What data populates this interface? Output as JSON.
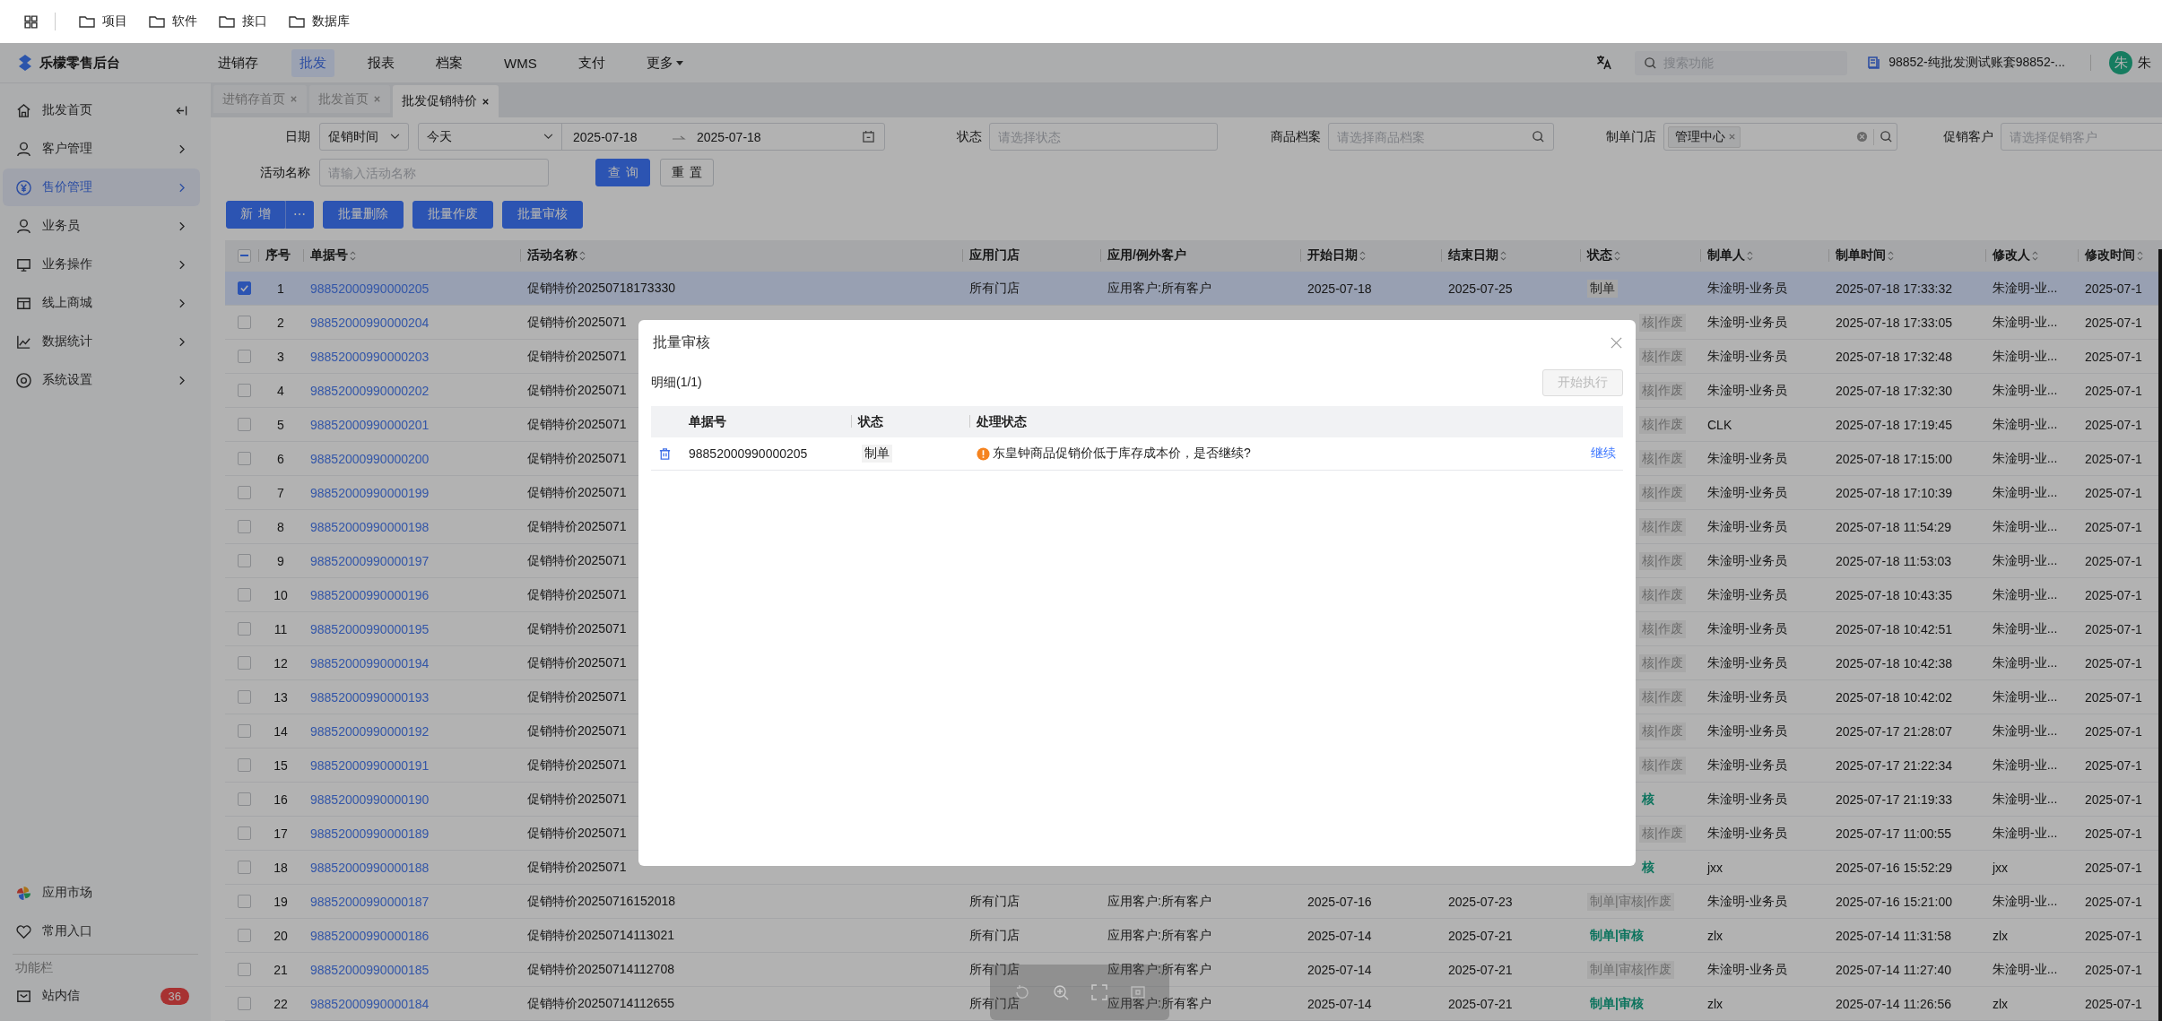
{
  "bookmarks": [
    {
      "label": "项目"
    },
    {
      "label": "软件"
    },
    {
      "label": "接口"
    },
    {
      "label": "数据库"
    }
  ],
  "logo": "乐檬零售后台",
  "top_menu": [
    {
      "label": "进销存",
      "selected": false,
      "kind": "link"
    },
    {
      "label": "批发",
      "selected": true,
      "kind": "link"
    },
    {
      "label": "报表",
      "selected": false,
      "kind": "link"
    },
    {
      "label": "档案",
      "selected": false,
      "kind": "link"
    },
    {
      "label": "WMS",
      "selected": false,
      "kind": "link"
    },
    {
      "label": "支付",
      "selected": false,
      "kind": "link"
    },
    {
      "label": "更多",
      "selected": false,
      "kind": "dropdown"
    }
  ],
  "header": {
    "search": {
      "placeholder": "搜索功能"
    },
    "account": "98852-纯批发测试账套98852-...",
    "avatar": "朱",
    "user": "朱"
  },
  "sidebar": {
    "items": [
      {
        "label": "批发首页",
        "selected": false,
        "kind": "collapse"
      },
      {
        "label": "客户管理",
        "selected": false,
        "kind": "chevron"
      },
      {
        "label": "售价管理",
        "selected": true,
        "kind": "chevron"
      },
      {
        "label": "业务员",
        "selected": false,
        "kind": "chevron"
      },
      {
        "label": "业务操作",
        "selected": false,
        "kind": "chevron"
      },
      {
        "label": "线上商城",
        "selected": false,
        "kind": "chevron"
      },
      {
        "label": "数据统计",
        "selected": false,
        "kind": "chevron"
      },
      {
        "label": "系统设置",
        "selected": false,
        "kind": "chevron"
      }
    ],
    "bottom": [
      {
        "label": "应用市场"
      },
      {
        "label": "常用入口"
      }
    ],
    "section": "功能栏",
    "inbox": {
      "label": "站内信",
      "badge": "36"
    }
  },
  "tabs": [
    {
      "label": "进销存首页",
      "selected": false
    },
    {
      "label": "批发首页",
      "selected": false
    },
    {
      "label": "批发促销特价",
      "selected": true
    }
  ],
  "filters": {
    "date": {
      "label": "日期",
      "type": "促销时间",
      "preset": "今天",
      "from": "2025-07-18",
      "to": "2025-07-18"
    },
    "status": {
      "label": "状态",
      "placeholder": "请选择状态"
    },
    "product": {
      "label": "商品档案",
      "placeholder": "请选择商品档案"
    },
    "store": {
      "label": "制单门店",
      "tag": "管理中心"
    },
    "customer": {
      "label": "促销客户",
      "placeholder": "请选择促销客户"
    },
    "activity": {
      "label": "活动名称",
      "placeholder": "请输入活动名称"
    },
    "query": "查询",
    "reset": "重置"
  },
  "toolbar": {
    "add": "新增",
    "more": "⋯",
    "actions": [
      "批量删除",
      "批量作废",
      "批量审核"
    ]
  },
  "table": {
    "select_all": {
      "indeterminate": true
    },
    "columns": [
      {
        "label": "序号",
        "sortable": false
      },
      {
        "label": "单据号",
        "sortable": true
      },
      {
        "label": "活动名称",
        "sortable": true
      },
      {
        "label": "应用门店",
        "sortable": false
      },
      {
        "label": "应用/例外客户",
        "sortable": false
      },
      {
        "label": "开始日期",
        "sortable": true
      },
      {
        "label": "结束日期",
        "sortable": true
      },
      {
        "label": "状态",
        "sortable": true
      },
      {
        "label": "制单人",
        "sortable": true
      },
      {
        "label": "制单时间",
        "sortable": true
      },
      {
        "label": "修改人",
        "sortable": true
      },
      {
        "label": "修改时间",
        "sortable": true
      }
    ],
    "rows": [
      {
        "no": "1",
        "id": "98852000990000205",
        "name": "促销特价20250718173330",
        "store": "所有门店",
        "customer": "应用客户:所有客户",
        "start": "2025-07-18",
        "end": "2025-07-25",
        "status": {
          "text": "制单",
          "kind": "draft"
        },
        "creator": "朱淦明-业务员",
        "created": "2025-07-18 17:33:32",
        "modifier": "朱淦明-业...",
        "modified": "2025-07-1",
        "checked": true,
        "selected": true
      },
      {
        "no": "2",
        "id": "98852000990000204",
        "name": "促销特价2025071",
        "status": {
          "text": "核|作废",
          "kind": "void"
        },
        "creator": "朱淦明-业务员",
        "created": "2025-07-18 17:33:05",
        "modifier": "朱淦明-业...",
        "modified": "2025-07-1",
        "checked": false,
        "selected": false
      },
      {
        "no": "3",
        "id": "98852000990000203",
        "name": "促销特价2025071",
        "status": {
          "text": "核|作废",
          "kind": "void"
        },
        "creator": "朱淦明-业务员",
        "created": "2025-07-18 17:32:48",
        "modifier": "朱淦明-业...",
        "modified": "2025-07-1",
        "checked": false,
        "selected": false
      },
      {
        "no": "4",
        "id": "98852000990000202",
        "name": "促销特价2025071",
        "status": {
          "text": "核|作废",
          "kind": "void"
        },
        "creator": "朱淦明-业务员",
        "created": "2025-07-18 17:32:30",
        "modifier": "朱淦明-业...",
        "modified": "2025-07-1",
        "checked": false,
        "selected": false
      },
      {
        "no": "5",
        "id": "98852000990000201",
        "name": "促销特价2025071",
        "status": {
          "text": "核|作废",
          "kind": "void"
        },
        "creator": "CLK",
        "created": "2025-07-18 17:19:45",
        "modifier": "朱淦明-业...",
        "modified": "2025-07-1",
        "checked": false,
        "selected": false
      },
      {
        "no": "6",
        "id": "98852000990000200",
        "name": "促销特价2025071",
        "status": {
          "text": "核|作废",
          "kind": "void"
        },
        "creator": "朱淦明-业务员",
        "created": "2025-07-18 17:15:00",
        "modifier": "朱淦明-业...",
        "modified": "2025-07-1",
        "checked": false,
        "selected": false
      },
      {
        "no": "7",
        "id": "98852000990000199",
        "name": "促销特价2025071",
        "status": {
          "text": "核|作废",
          "kind": "void"
        },
        "creator": "朱淦明-业务员",
        "created": "2025-07-18 17:10:39",
        "modifier": "朱淦明-业...",
        "modified": "2025-07-1",
        "checked": false,
        "selected": false
      },
      {
        "no": "8",
        "id": "98852000990000198",
        "name": "促销特价2025071",
        "status": {
          "text": "核|作废",
          "kind": "void"
        },
        "creator": "朱淦明-业务员",
        "created": "2025-07-18 11:54:29",
        "modifier": "朱淦明-业...",
        "modified": "2025-07-1",
        "checked": false,
        "selected": false
      },
      {
        "no": "9",
        "id": "98852000990000197",
        "name": "促销特价2025071",
        "status": {
          "text": "核|作废",
          "kind": "void"
        },
        "creator": "朱淦明-业务员",
        "created": "2025-07-18 11:53:03",
        "modifier": "朱淦明-业...",
        "modified": "2025-07-1",
        "checked": false,
        "selected": false
      },
      {
        "no": "10",
        "id": "98852000990000196",
        "name": "促销特价2025071",
        "status": {
          "text": "核|作废",
          "kind": "void"
        },
        "creator": "朱淦明-业务员",
        "created": "2025-07-18 10:43:35",
        "modifier": "朱淦明-业...",
        "modified": "2025-07-1",
        "checked": false,
        "selected": false
      },
      {
        "no": "11",
        "id": "98852000990000195",
        "name": "促销特价2025071",
        "status": {
          "text": "核|作废",
          "kind": "void"
        },
        "creator": "朱淦明-业务员",
        "created": "2025-07-18 10:42:51",
        "modifier": "朱淦明-业...",
        "modified": "2025-07-1",
        "checked": false,
        "selected": false
      },
      {
        "no": "12",
        "id": "98852000990000194",
        "name": "促销特价2025071",
        "status": {
          "text": "核|作废",
          "kind": "void"
        },
        "creator": "朱淦明-业务员",
        "created": "2025-07-18 10:42:38",
        "modifier": "朱淦明-业...",
        "modified": "2025-07-1",
        "checked": false,
        "selected": false
      },
      {
        "no": "13",
        "id": "98852000990000193",
        "name": "促销特价2025071",
        "status": {
          "text": "核|作废",
          "kind": "void"
        },
        "creator": "朱淦明-业务员",
        "created": "2025-07-18 10:42:02",
        "modifier": "朱淦明-业...",
        "modified": "2025-07-1",
        "checked": false,
        "selected": false
      },
      {
        "no": "14",
        "id": "98852000990000192",
        "name": "促销特价2025071",
        "status": {
          "text": "核|作废",
          "kind": "void"
        },
        "creator": "朱淦明-业务员",
        "created": "2025-07-17 21:28:07",
        "modifier": "朱淦明-业...",
        "modified": "2025-07-1",
        "checked": false,
        "selected": false
      },
      {
        "no": "15",
        "id": "98852000990000191",
        "name": "促销特价2025071",
        "status": {
          "text": "核|作废",
          "kind": "void"
        },
        "creator": "朱淦明-业务员",
        "created": "2025-07-17 21:22:34",
        "modifier": "朱淦明-业...",
        "modified": "2025-07-1",
        "checked": false,
        "selected": false
      },
      {
        "no": "16",
        "id": "98852000990000190",
        "name": "促销特价2025071",
        "status": {
          "text": "核",
          "kind": "audit"
        },
        "creator": "朱淦明-业务员",
        "created": "2025-07-17 21:19:33",
        "modifier": "朱淦明-业...",
        "modified": "2025-07-1",
        "checked": false,
        "selected": false
      },
      {
        "no": "17",
        "id": "98852000990000189",
        "name": "促销特价2025071",
        "status": {
          "text": "核|作废",
          "kind": "void"
        },
        "creator": "朱淦明-业务员",
        "created": "2025-07-17 11:00:55",
        "modifier": "朱淦明-业...",
        "modified": "2025-07-1",
        "checked": false,
        "selected": false
      },
      {
        "no": "18",
        "id": "98852000990000188",
        "name": "促销特价2025071",
        "status": {
          "text": "核",
          "kind": "audit"
        },
        "creator": "jxx",
        "created": "2025-07-16 15:52:29",
        "modifier": "jxx",
        "modified": "2025-07-1",
        "checked": false,
        "selected": false
      },
      {
        "no": "19",
        "id": "98852000990000187",
        "name": "促销特价20250716152018",
        "store": "所有门店",
        "customer": "应用客户:所有客户",
        "start": "2025-07-16",
        "end": "2025-07-23",
        "status": {
          "text": "制单|审核|作废",
          "kind": "void"
        },
        "creator": "朱淦明-业务员",
        "created": "2025-07-16 15:21:00",
        "modifier": "朱淦明-业...",
        "modified": "2025-07-1",
        "checked": false,
        "selected": false
      },
      {
        "no": "20",
        "id": "98852000990000186",
        "name": "促销特价20250714113021",
        "store": "所有门店",
        "customer": "应用客户:所有客户",
        "start": "2025-07-14",
        "end": "2025-07-21",
        "status": {
          "text": "制单|审核",
          "kind": "audit"
        },
        "creator": "zlx",
        "created": "2025-07-14 11:31:58",
        "modifier": "zlx",
        "modified": "2025-07-1",
        "checked": false,
        "selected": false
      },
      {
        "no": "21",
        "id": "98852000990000185",
        "name": "促销特价20250714112708",
        "store": "所有门店",
        "customer": "应用客户:所有客户",
        "start": "2025-07-14",
        "end": "2025-07-21",
        "status": {
          "text": "制单|审核|作废",
          "kind": "void"
        },
        "creator": "朱淦明-业务员",
        "created": "2025-07-14 11:27:40",
        "modifier": "朱淦明-业...",
        "modified": "2025-07-1",
        "checked": false,
        "selected": false
      },
      {
        "no": "22",
        "id": "98852000990000184",
        "name": "促销特价20250714112655",
        "store": "所有门店",
        "customer": "应用客户:所有客户",
        "start": "2025-07-14",
        "end": "2025-07-21",
        "status": {
          "text": "制单|审核",
          "kind": "audit"
        },
        "creator": "zlx",
        "created": "2025-07-14 11:26:56",
        "modifier": "zlx",
        "modified": "2025-07-1",
        "checked": false,
        "selected": false
      }
    ]
  },
  "modal": {
    "title": "批量审核",
    "detail": "明细(1/1)",
    "start_button": {
      "label": "开始执行",
      "disabled": true
    },
    "columns": [
      "单据号",
      "状态",
      "处理状态"
    ],
    "rows": [
      {
        "id": "98852000990000205",
        "status": "制单",
        "message": "东皇钟商品促销价低于库存成本价，是否继续?",
        "action": "继续"
      }
    ]
  }
}
